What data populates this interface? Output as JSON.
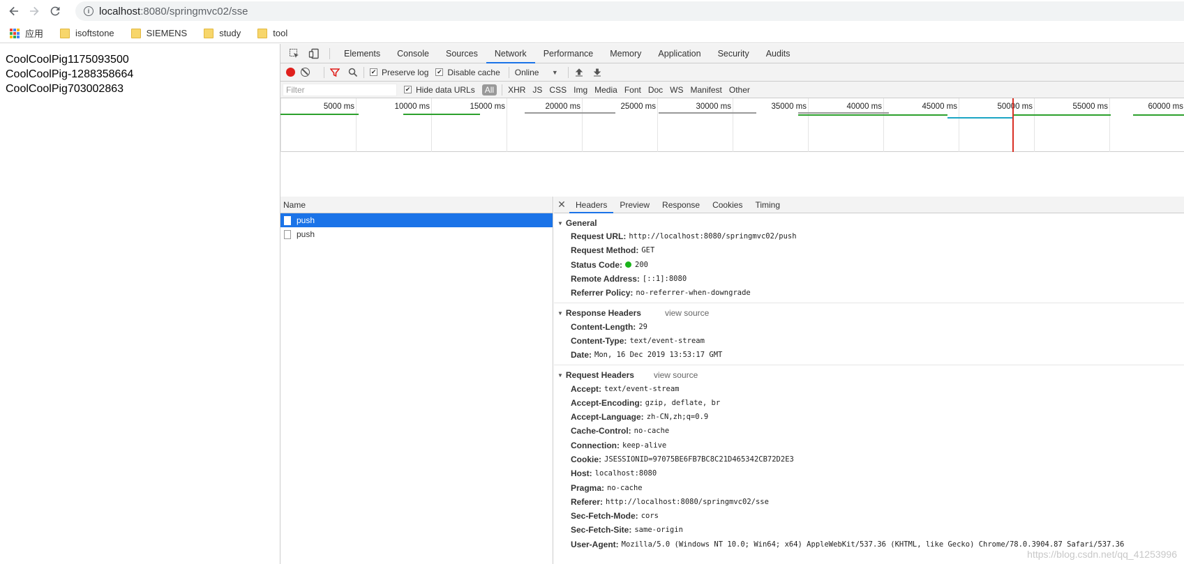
{
  "browser": {
    "url_host": "localhost",
    "url_rest": ":8080/springmvc02/sse",
    "bookmarks": [
      {
        "label": "应用",
        "icon": "apps-grid-icon"
      },
      {
        "label": "isoftstone",
        "icon": "folder-icon"
      },
      {
        "label": "SIEMENS",
        "icon": "folder-icon"
      },
      {
        "label": "study",
        "icon": "folder-icon"
      },
      {
        "label": "tool",
        "icon": "folder-icon"
      }
    ]
  },
  "page": {
    "lines": [
      "CoolCoolPig1175093500",
      "CoolCoolPig-1288358664",
      "CoolCoolPig703002863"
    ]
  },
  "devtools": {
    "tabs": [
      "Elements",
      "Console",
      "Sources",
      "Network",
      "Performance",
      "Memory",
      "Application",
      "Security",
      "Audits"
    ],
    "active_tab": "Network",
    "toolbar": {
      "preserve_log": "Preserve log",
      "disable_cache": "Disable cache",
      "throttle": "Online"
    },
    "filter": {
      "placeholder": "Filter",
      "hide_data_urls": "Hide data URLs",
      "types": [
        "All",
        "XHR",
        "JS",
        "CSS",
        "Img",
        "Media",
        "Font",
        "Doc",
        "WS",
        "Manifest",
        "Other"
      ]
    },
    "overview": {
      "ticks": [
        "5000 ms",
        "10000 ms",
        "15000 ms",
        "20000 ms",
        "25000 ms",
        "30000 ms",
        "35000 ms",
        "40000 ms",
        "45000 ms",
        "50000 ms",
        "55000 ms",
        "60000 ms"
      ]
    },
    "requests": {
      "header": "Name",
      "rows": [
        {
          "name": "push",
          "selected": true
        },
        {
          "name": "push",
          "selected": false
        }
      ]
    },
    "detail": {
      "tabs": [
        "Headers",
        "Preview",
        "Response",
        "Cookies",
        "Timing"
      ],
      "active_tab": "Headers",
      "general": {
        "title": "General",
        "rows": [
          {
            "k": "Request URL:",
            "v": "http://localhost:8080/springmvc02/push"
          },
          {
            "k": "Request Method:",
            "v": "GET"
          },
          {
            "k": "Status Code:",
            "v": "200"
          },
          {
            "k": "Remote Address:",
            "v": "[::1]:8080"
          },
          {
            "k": "Referrer Policy:",
            "v": "no-referrer-when-downgrade"
          }
        ]
      },
      "response_headers": {
        "title": "Response Headers",
        "view_source": "view source",
        "rows": [
          {
            "k": "Content-Length:",
            "v": "29"
          },
          {
            "k": "Content-Type:",
            "v": "text/event-stream"
          },
          {
            "k": "Date:",
            "v": "Mon, 16 Dec 2019 13:53:17 GMT"
          }
        ]
      },
      "request_headers": {
        "title": "Request Headers",
        "view_source": "view source",
        "rows": [
          {
            "k": "Accept:",
            "v": "text/event-stream"
          },
          {
            "k": "Accept-Encoding:",
            "v": "gzip, deflate, br"
          },
          {
            "k": "Accept-Language:",
            "v": "zh-CN,zh;q=0.9"
          },
          {
            "k": "Cache-Control:",
            "v": "no-cache"
          },
          {
            "k": "Connection:",
            "v": "keep-alive"
          },
          {
            "k": "Cookie:",
            "v": "JSESSIONID=97075BE6FB7BC8C21D465342CB72D2E3"
          },
          {
            "k": "Host:",
            "v": "localhost:8080"
          },
          {
            "k": "Pragma:",
            "v": "no-cache"
          },
          {
            "k": "Referer:",
            "v": "http://localhost:8080/springmvc02/sse"
          },
          {
            "k": "Sec-Fetch-Mode:",
            "v": "cors"
          },
          {
            "k": "Sec-Fetch-Site:",
            "v": "same-origin"
          },
          {
            "k": "User-Agent:",
            "v": "Mozilla/5.0 (Windows NT 10.0; Win64; x64) AppleWebKit/537.36 (KHTML, like Gecko) Chrome/78.0.3904.87 Safari/537.36"
          }
        ]
      }
    }
  },
  "watermark": "https://blog.csdn.net/qq_41253996",
  "colors": {
    "accent": "#1a73e8",
    "record": "#e0201d",
    "status_ok": "#1bb41b"
  }
}
